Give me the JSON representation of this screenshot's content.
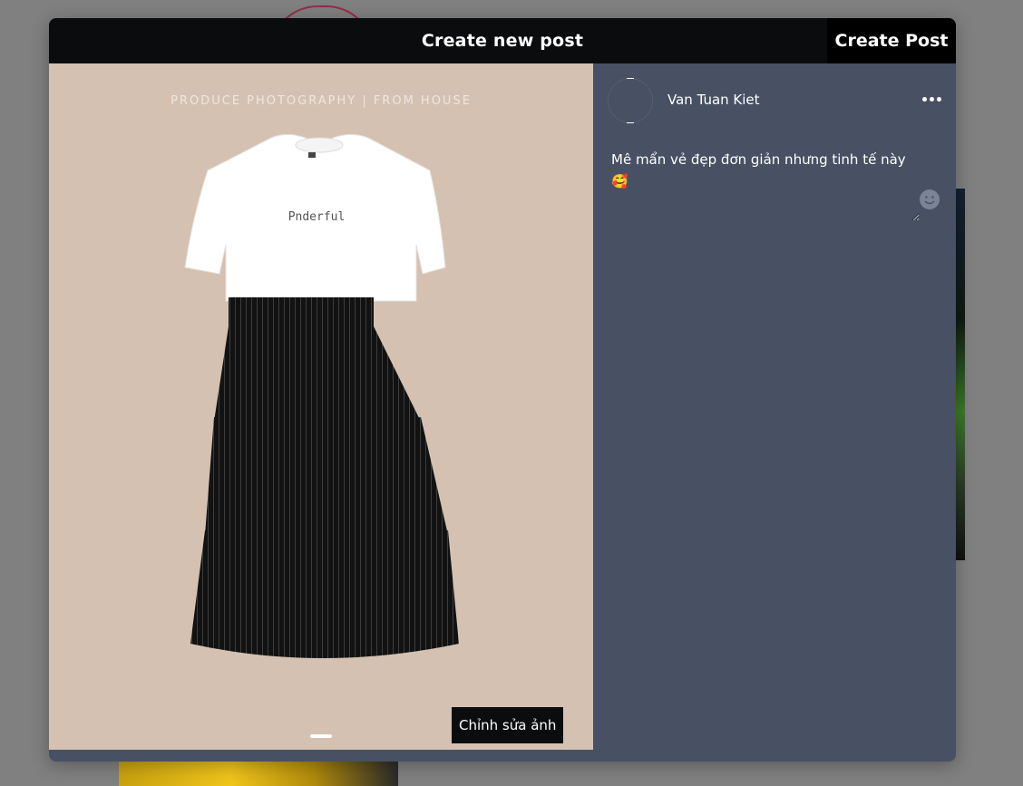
{
  "modal": {
    "title": "Create new post",
    "submit_label": "Create Post"
  },
  "image": {
    "header_text": "PRODUCE PHOTOGRAPHY | FROM HOUSE",
    "shirt_print": "Pnderful",
    "edit_label": "Chỉnh sửa ảnh",
    "product_icon": "skirt-and-tshirt-photo"
  },
  "post": {
    "username": "Van Tuan Kiet",
    "caption": "Mê mẩn vẻ đẹp đơn giản nhưng tinh tế này 🥰",
    "more_icon": "more-options-icon",
    "emoji_icon": "emoji-icon"
  },
  "colors": {
    "overlay": "#808080",
    "header": "#0b0c0e",
    "panel": "#475163",
    "photo_bg": "#d4c1b2"
  }
}
